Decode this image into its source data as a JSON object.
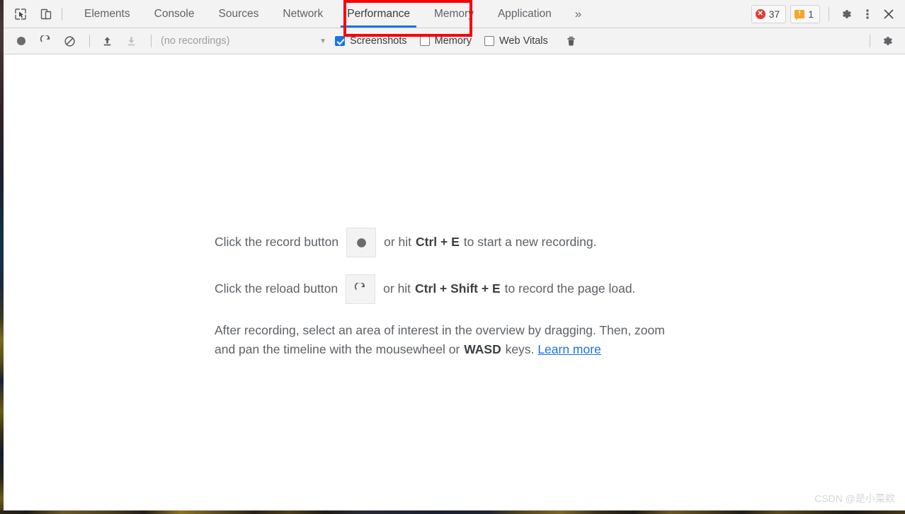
{
  "window": {
    "title": "Chrome DevTools — Performance panel"
  },
  "tabbar": {
    "inspect_icon": "inspect-element-icon",
    "device_icon": "device-toolbar-icon",
    "tabs": [
      {
        "label": "Elements",
        "active": false
      },
      {
        "label": "Console",
        "active": false
      },
      {
        "label": "Sources",
        "active": false
      },
      {
        "label": "Network",
        "active": false
      },
      {
        "label": "Performance",
        "active": true
      },
      {
        "label": "Memory",
        "active": false
      },
      {
        "label": "Application",
        "active": false
      }
    ],
    "more_tabs_label": "»",
    "errors": {
      "icon": "error-icon",
      "count": "37"
    },
    "warnings": {
      "icon": "warning-icon",
      "count": "1"
    },
    "settings_label": "settings-gear-icon",
    "menu_label": "more-options-icon",
    "close_label": "close-icon",
    "active_tab_underline_color": "#1a73e8",
    "highlight_color": "#fb0007"
  },
  "paneltoolbar": {
    "record_label": "record-icon",
    "reload_label": "reload-record-icon",
    "clear_label": "clear-icon",
    "load_label": "load-profile-icon",
    "save_label": "save-profile-icon",
    "recordings_value": "(no recordings)",
    "recordings_arrow": "▼",
    "checkboxes": [
      {
        "label": "Screenshots",
        "checked": true
      },
      {
        "label": "Memory",
        "checked": false
      },
      {
        "label": "Web Vitals",
        "checked": false
      }
    ],
    "trash_label": "delete-icon",
    "capture_settings_label": "capture-settings-gear-icon"
  },
  "landing": {
    "record_hint": {
      "prefix": "Click the record button",
      "button_icon": "record-icon",
      "middle": "or hit",
      "shortcut": "Ctrl + E",
      "suffix": "to start a new recording."
    },
    "reload_hint": {
      "prefix": "Click the reload button",
      "button_icon": "reload-icon",
      "middle": "or hit",
      "shortcut": "Ctrl + Shift + E",
      "suffix": "to record the page load."
    },
    "paragraph": {
      "part1": "After recording, select an area of interest in the overview by dragging. Then, zoom and pan the timeline with the mousewheel or",
      "emphasis": "WASD",
      "part2": "keys.",
      "link": "Learn more"
    }
  },
  "watermark": {
    "text": "CSDN @是小菜欸"
  }
}
